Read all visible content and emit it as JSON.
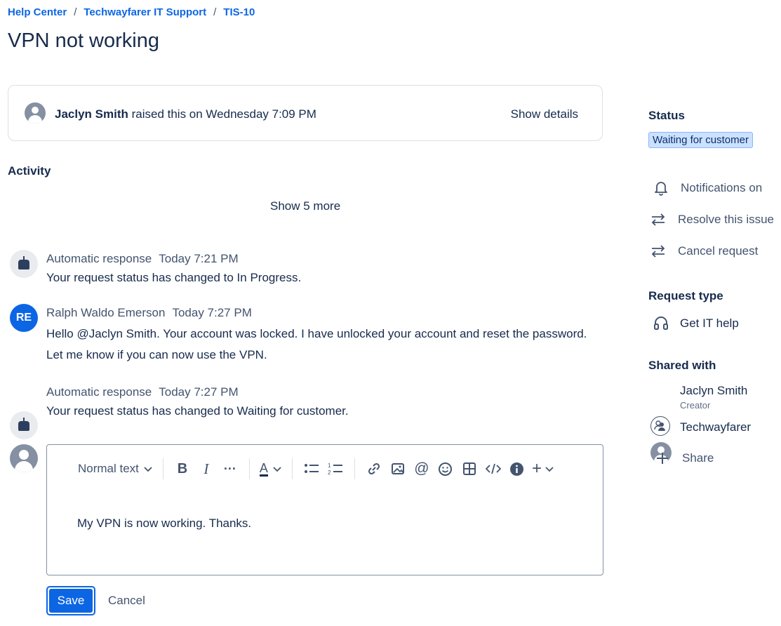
{
  "breadcrumb": [
    "Help Center",
    "Techwayfarer IT Support",
    "TIS-10"
  ],
  "title": "VPN not working",
  "raised": {
    "name": "Jaclyn Smith",
    "text": " raised this on Wednesday 7:09 PM",
    "show_details": "Show details"
  },
  "activity": {
    "heading": "Activity",
    "show_more": "Show 5 more",
    "entries": [
      {
        "name": "Automatic response",
        "time": "Today 7:21 PM",
        "body": "Your request status has changed to In Progress."
      },
      {
        "name": "Ralph Waldo Emerson",
        "initials": "RE",
        "time": "Today 7:27 PM",
        "body_line1": "Hello @Jaclyn Smith. Your account was locked. I have unlocked your account and reset the password.",
        "body_line2": "Let me know if you can now use the VPN."
      },
      {
        "name": "Automatic response",
        "time": "Today 7:27 PM",
        "body": "Your request status has changed to Waiting for customer."
      }
    ]
  },
  "editor": {
    "text_style": "Normal text",
    "content": "My VPN is now working. Thanks.",
    "save_label": "Save",
    "cancel_label": "Cancel"
  },
  "sidebar": {
    "status_heading": "Status",
    "status_value": "Waiting for customer",
    "actions": [
      "Notifications on",
      "Resolve this issue",
      "Cancel request"
    ],
    "request_type_heading": "Request type",
    "request_type": "Get IT help",
    "shared_heading": "Shared with",
    "shared": [
      {
        "name": "Jaclyn Smith",
        "role": "Creator"
      },
      {
        "name": "Techwayfarer"
      }
    ],
    "share_label": "Share"
  },
  "colors": {
    "link": "#0c66e4",
    "status_badge_bg": "#cce0ff",
    "primary_button": "#0c66e4"
  }
}
